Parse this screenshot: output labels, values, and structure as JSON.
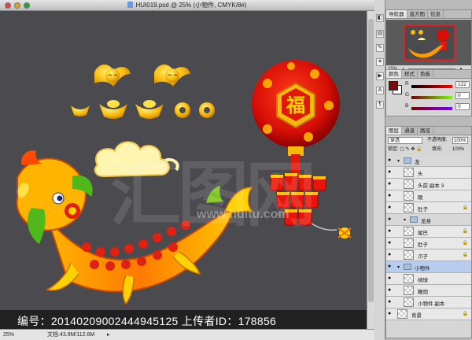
{
  "document": {
    "title": "HUI019.psd @ 25% (小物件, CMYK/8#)",
    "zoom": "25%",
    "doc_size": "文档:43.9M/112.8M"
  },
  "watermark": {
    "caption": "编号：20140209002444945125 上传者ID：178856",
    "big": "汇图网",
    "url": "www.huitu.com"
  },
  "artwork": {
    "fu_char": "福"
  },
  "navigator": {
    "tabs": [
      "导航器",
      "直方图",
      "信息"
    ],
    "zoom": "25%"
  },
  "color_panel": {
    "tabs": [
      "颜色",
      "样式",
      "色板"
    ],
    "r_label": "R",
    "g_label": "G",
    "b_label": "B",
    "r_value": "122",
    "g_value": "0",
    "b_value": "0",
    "fg": "#7a0000",
    "bg": "#ffffff"
  },
  "layers_panel": {
    "tabs": [
      "图层",
      "通道",
      "路径"
    ],
    "blend_mode": "穿透",
    "opacity_label": "不透明度:",
    "opacity": "100%",
    "lock_label": "锁定:",
    "fill_label": "填充:",
    "fill": "100%",
    "layers": [
      {
        "name": "龙",
        "kind": "group",
        "indent": 0
      },
      {
        "name": "头",
        "kind": "layer",
        "indent": 1
      },
      {
        "name": "头前 副本 3",
        "kind": "layer",
        "indent": 1
      },
      {
        "name": "眼",
        "kind": "layer",
        "indent": 1
      },
      {
        "name": "肚子",
        "kind": "layer",
        "indent": 1,
        "locked": true
      },
      {
        "name": "龙身",
        "kind": "group",
        "indent": 1
      },
      {
        "name": "尾巴",
        "kind": "layer",
        "indent": 1,
        "locked": true
      },
      {
        "name": "肚子",
        "kind": "layer",
        "indent": 1,
        "locked": true
      },
      {
        "name": "爪子",
        "kind": "layer",
        "indent": 1,
        "locked": true
      },
      {
        "name": "小物件",
        "kind": "group",
        "indent": 0,
        "selected": true
      },
      {
        "name": "绣球",
        "kind": "layer",
        "indent": 1
      },
      {
        "name": "鞭炮",
        "kind": "layer",
        "indent": 1
      },
      {
        "name": "小物件 副本",
        "kind": "layer",
        "indent": 1
      },
      {
        "name": "背景",
        "kind": "layer",
        "indent": 0,
        "locked": true
      }
    ]
  }
}
